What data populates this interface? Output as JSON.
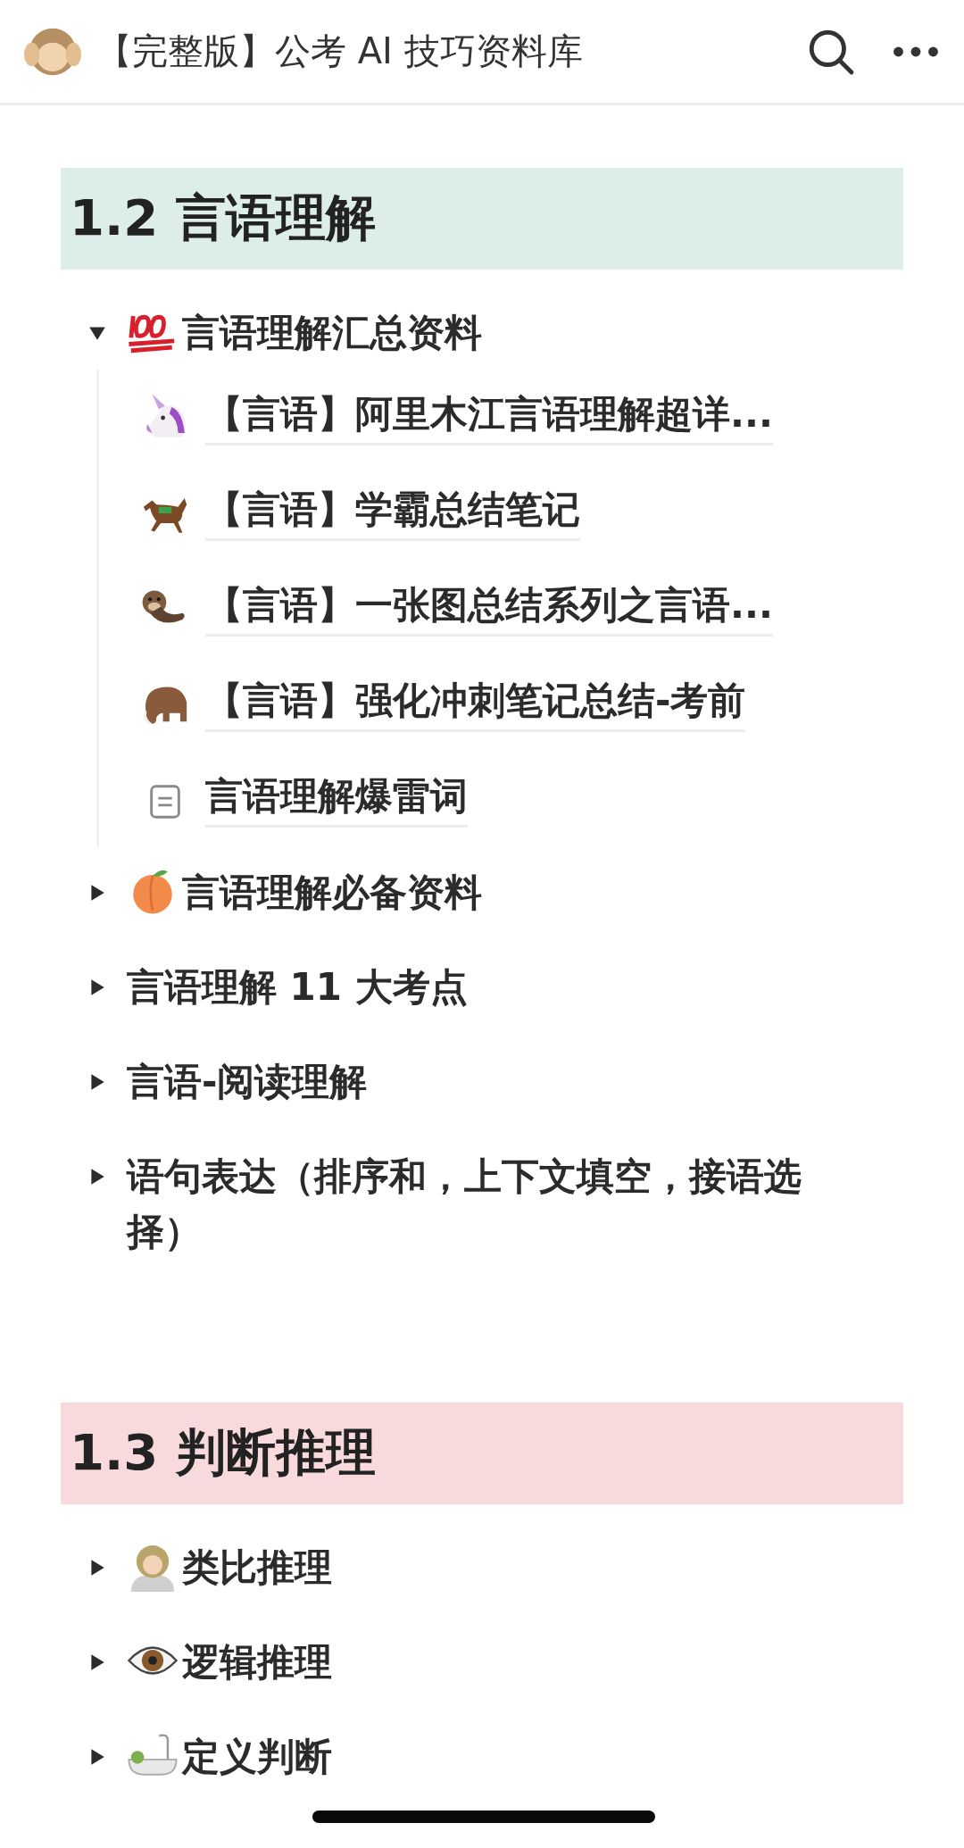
{
  "page": {
    "title": "【完整版】公考 AI 技巧资料库"
  },
  "sections": [
    {
      "heading": "1.2 言语理解",
      "color": "#ddedea",
      "items": [
        {
          "kind": "toggle",
          "label": "言语理解汇总资料",
          "expanded": true,
          "children": [
            {
              "kind": "page",
              "label": "【言语】阿里木江言语理解超详..."
            },
            {
              "kind": "page",
              "label": "【言语】学霸总结笔记"
            },
            {
              "kind": "page",
              "label": "【言语】一张图总结系列之言语..."
            },
            {
              "kind": "page",
              "label": "【言语】强化冲刺笔记总结-考前"
            },
            {
              "kind": "page",
              "label": "言语理解爆雷词"
            }
          ]
        },
        {
          "kind": "toggle",
          "label": "言语理解必备资料",
          "expanded": false
        },
        {
          "kind": "toggle",
          "label": "言语理解 11 大考点",
          "expanded": false
        },
        {
          "kind": "toggle",
          "label": "言语-阅读理解",
          "expanded": false
        },
        {
          "kind": "toggle",
          "label": "语句表达（排序和，上下文填空，接语选择）",
          "expanded": false
        }
      ]
    },
    {
      "heading": "1.3 判断推理",
      "color": "#f8d9dc",
      "items": [
        {
          "kind": "toggle",
          "label": "类比推理",
          "expanded": false
        },
        {
          "kind": "toggle",
          "label": "逻辑推理",
          "expanded": false
        },
        {
          "kind": "toggle",
          "label": "定义判断",
          "expanded": false
        }
      ]
    }
  ]
}
